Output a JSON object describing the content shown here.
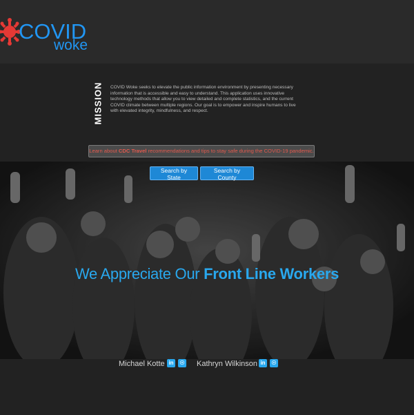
{
  "brand": {
    "covid": "COVID",
    "woke": "woke"
  },
  "mission": {
    "label": "MISSION",
    "text": "COVID Woke seeks to elevate the public information environment by presenting necessary information that is accessible and easy to understand. This application uses innovative technology methods that allow you to view detailed and complete statistics, and the current COVID climate between multiple regions. Our goal is to empower and inspire humans to live with elevated integrity, mindfulness, and respect."
  },
  "travel": {
    "prefix": "Learn about ",
    "bold": "CDC Travel",
    "suffix": " recommendations and tips to stay safe during the COVID-19 pandemic."
  },
  "search": {
    "by_state": "Search by State",
    "by_county": "Search by County"
  },
  "hero": {
    "headline_light": "We Appreciate Our ",
    "headline_bold": "Front Line Workers"
  },
  "authors": [
    {
      "name": "Michael Kotte",
      "icons": [
        "linkedin-icon",
        "github-icon"
      ]
    },
    {
      "name": "Kathryn Wilkinson",
      "icons": [
        "linkedin-icon",
        "github-icon"
      ]
    }
  ],
  "colors": {
    "accent": "#2196f3",
    "virus": "#e53935",
    "alert": "#e05a4e",
    "background": "#252525"
  }
}
